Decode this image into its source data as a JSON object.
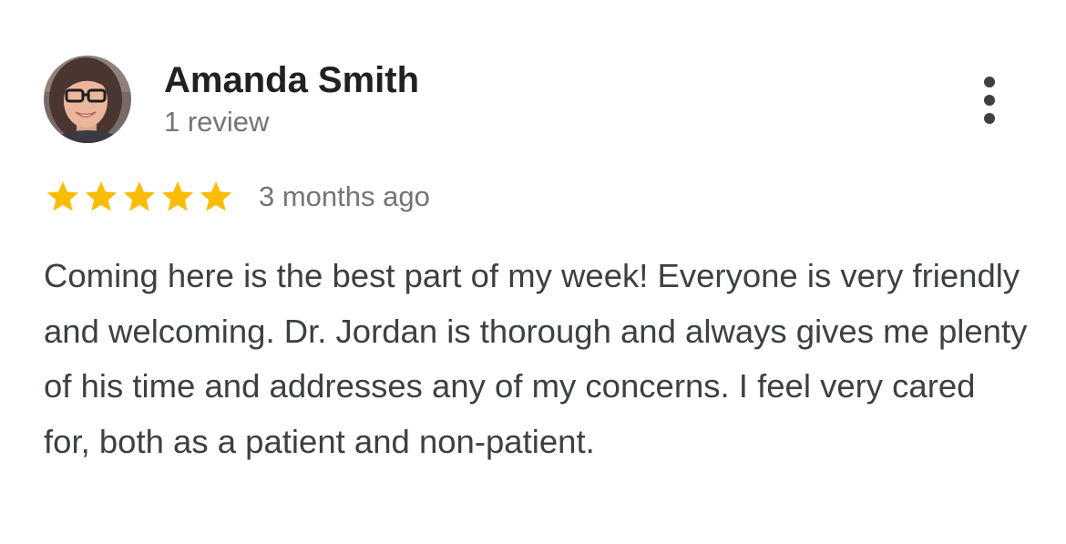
{
  "reviewer": {
    "name": "Amanda Smith",
    "review_count": "1 review",
    "avatar_icon": "person-with-glasses-avatar"
  },
  "rating": {
    "stars": 5,
    "max_stars": 5,
    "star_color": "#fbbc04",
    "date": "3 months ago"
  },
  "review": {
    "text": "Coming here is the best part of my week! Everyone is very friendly and welcoming. Dr. Jordan is thorough and always gives me plenty of his time and addresses any of my concerns. I feel very cared for, both as a patient and non-patient."
  },
  "menu": {
    "icon": "more-vertical-icon"
  }
}
